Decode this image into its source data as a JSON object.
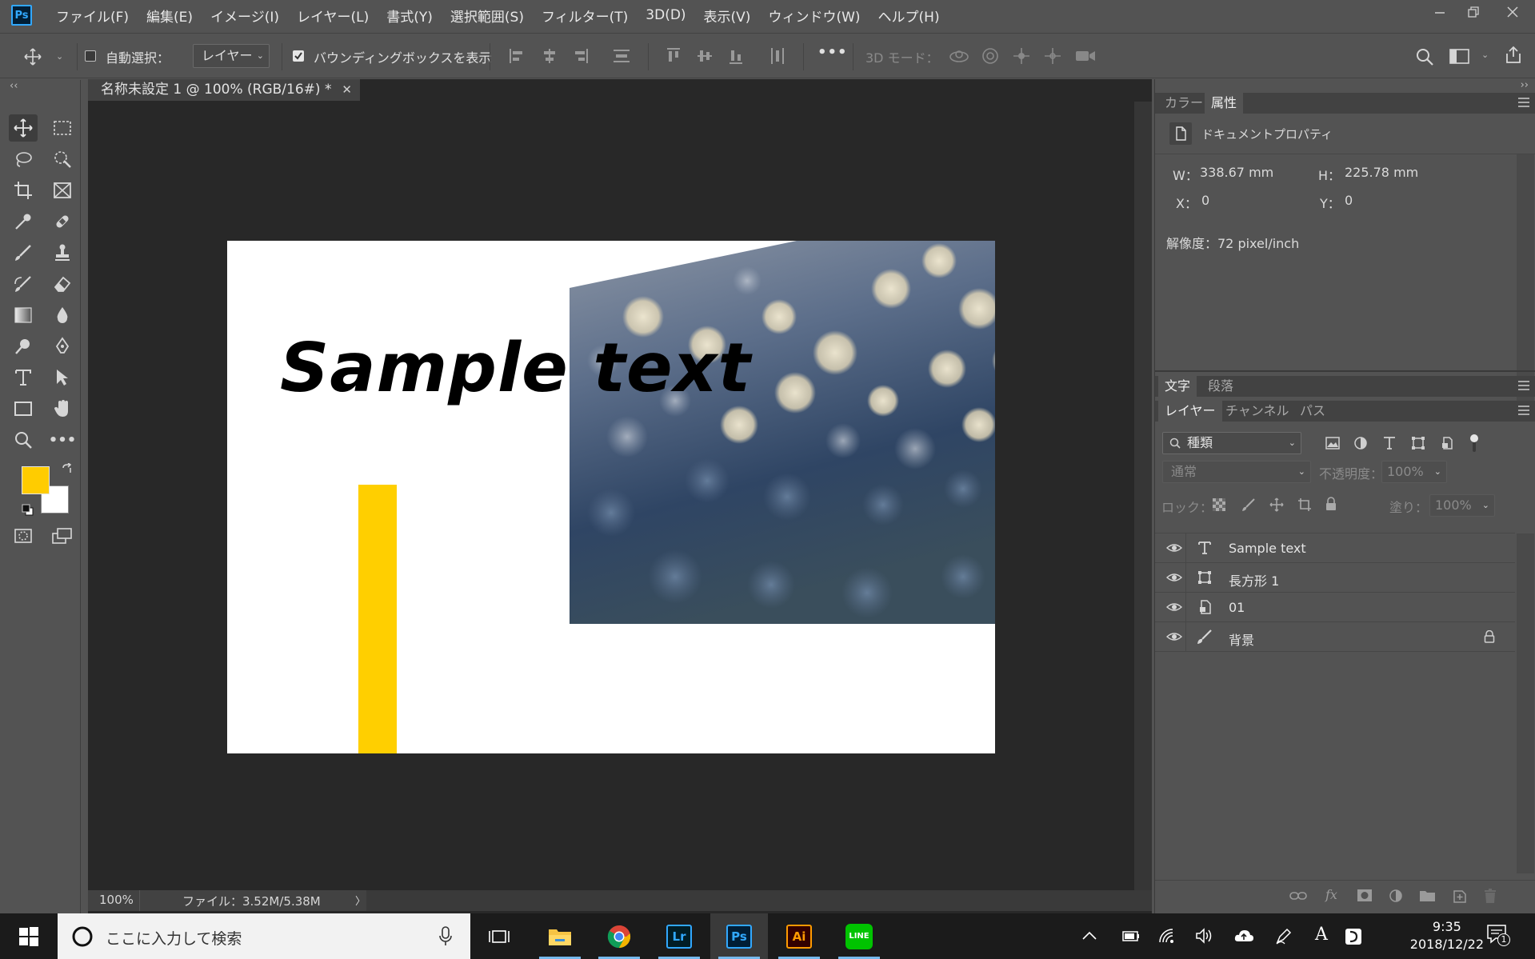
{
  "app": {
    "logo": "Ps",
    "menu": [
      "ファイル(F)",
      "編集(E)",
      "イメージ(I)",
      "レイヤー(L)",
      "書式(Y)",
      "選択範囲(S)",
      "フィルター(T)",
      "3D(D)",
      "表示(V)",
      "ウィンドウ(W)",
      "ヘルプ(H)"
    ]
  },
  "options_bar": {
    "auto_select_label": "自動選択：",
    "auto_select_target": "レイヤー",
    "bounding_box_label": "バウンディングボックスを表示",
    "more_label": "•••",
    "mode_3d_label": "3D モード："
  },
  "document": {
    "tab_title": "名称未設定 1 @ 100% (RGB/16#) *",
    "canvas_text": "Sample text",
    "zoom": "100%",
    "file_info": "ファイル：3.52M/5.38M",
    "status_arrow": "〉"
  },
  "colors": {
    "foreground": "#ffcc00",
    "background": "#ffffff",
    "accent_rect": "#ffcf00"
  },
  "properties_panel": {
    "tabs": [
      "カラー",
      "属性"
    ],
    "title": "ドキュメントプロパティ",
    "w_label": "W：",
    "w_value": "338.67 mm",
    "h_label": "H：",
    "h_value": "225.78 mm",
    "x_label": "X：",
    "x_value": "0",
    "y_label": "Y：",
    "y_value": "0",
    "resolution": "解像度：72 pixel/inch"
  },
  "type_panel": {
    "tabs": [
      "文字",
      "段落"
    ]
  },
  "layers_panel": {
    "tabs": [
      "レイヤー",
      "チャンネル",
      "パス"
    ],
    "filter_label": "種類",
    "blend_mode": "通常",
    "opacity_label": "不透明度：",
    "opacity_value": "100%",
    "lock_label": "ロック：",
    "fill_label": "塗り：",
    "fill_value": "100%",
    "layers": [
      {
        "name": "Sample text",
        "type": "text-icon"
      },
      {
        "name": "長方形 1",
        "type": "shape-icon"
      },
      {
        "name": "01",
        "type": "smart-object-icon"
      },
      {
        "name": "背景",
        "type": "brush-icon",
        "locked": true
      }
    ]
  },
  "taskbar": {
    "search_placeholder": "ここに入力して検索",
    "apps": [
      "task-view",
      "file-explorer",
      "chrome",
      "Lr",
      "Ps",
      "Ai",
      "LINE"
    ],
    "time": "9:35",
    "date": "2018/12/22",
    "notification_count": "1"
  }
}
